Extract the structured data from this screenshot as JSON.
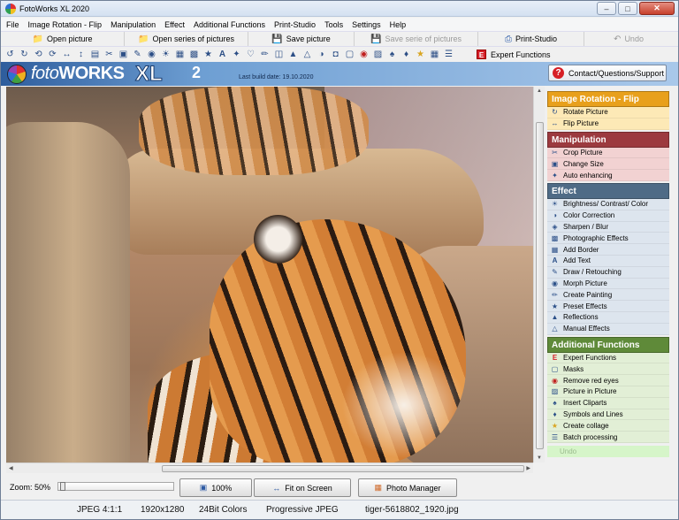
{
  "window": {
    "title": "FotoWorks XL 2020"
  },
  "menu": [
    "File",
    "Image Rotation - Flip",
    "Manipulation",
    "Effect",
    "Additional Functions",
    "Print-Studio",
    "Tools",
    "Settings",
    "Help"
  ],
  "toolbar": {
    "open_picture": "Open picture",
    "open_series": "Open series of pictures",
    "save_picture": "Save picture",
    "save_series": "Save serie of pictures",
    "print_studio": "Print-Studio",
    "undo": "Undo",
    "expert_functions": "Expert Functions"
  },
  "banner": {
    "logo_foto": "foto",
    "logo_works": "WORKS",
    "logo_xl": "XL",
    "logo_version": "2",
    "build_date": "Last build date: 19.10.2020",
    "support_button": "Contact/Questions/Support"
  },
  "sidebar": {
    "rotation": {
      "title": "Image Rotation - Flip",
      "color": "#e8a01c",
      "bg": "#fde9b6",
      "items": [
        "Rotate Picture",
        "Flip Picture"
      ]
    },
    "manipulation": {
      "title": "Manipulation",
      "color": "#9c3a3f",
      "bg": "#f2d2d2",
      "items": [
        "Crop Picture",
        "Change Size",
        "Auto enhancing"
      ]
    },
    "effect": {
      "title": "Effect",
      "color": "#4f6b86",
      "bg": "#dde5ee",
      "items": [
        "Brightness/ Contrast/ Color",
        "Color Correction",
        "Sharpen / Blur",
        "Photographic Effects",
        "Add Border",
        "Add Text",
        "Draw / Retouching",
        "Morph Picture",
        "Create Painting",
        "Preset Effects",
        "Reflections",
        "Manual Effects"
      ]
    },
    "additional": {
      "title": "Additional Functions",
      "color": "#5f8a39",
      "bg": "#e2efd6",
      "items": [
        "Expert Functions",
        "Masks",
        "Remove red eyes",
        "Picture in Picture",
        "Insert Cliparts",
        "Symbols and Lines",
        "Create collage",
        "Batch processing"
      ]
    },
    "undo": "Undo"
  },
  "zoom": {
    "label": "Zoom: 50%",
    "btn_100": "100%",
    "btn_fit": "Fit on Screen",
    "btn_manager": "Photo Manager"
  },
  "status": {
    "format": "JPEG  4:1:1",
    "size": "1920x1280",
    "colors": "24Bit Colors",
    "type": "Progressive JPEG",
    "file": "tiger-5618802_1920.jpg"
  }
}
